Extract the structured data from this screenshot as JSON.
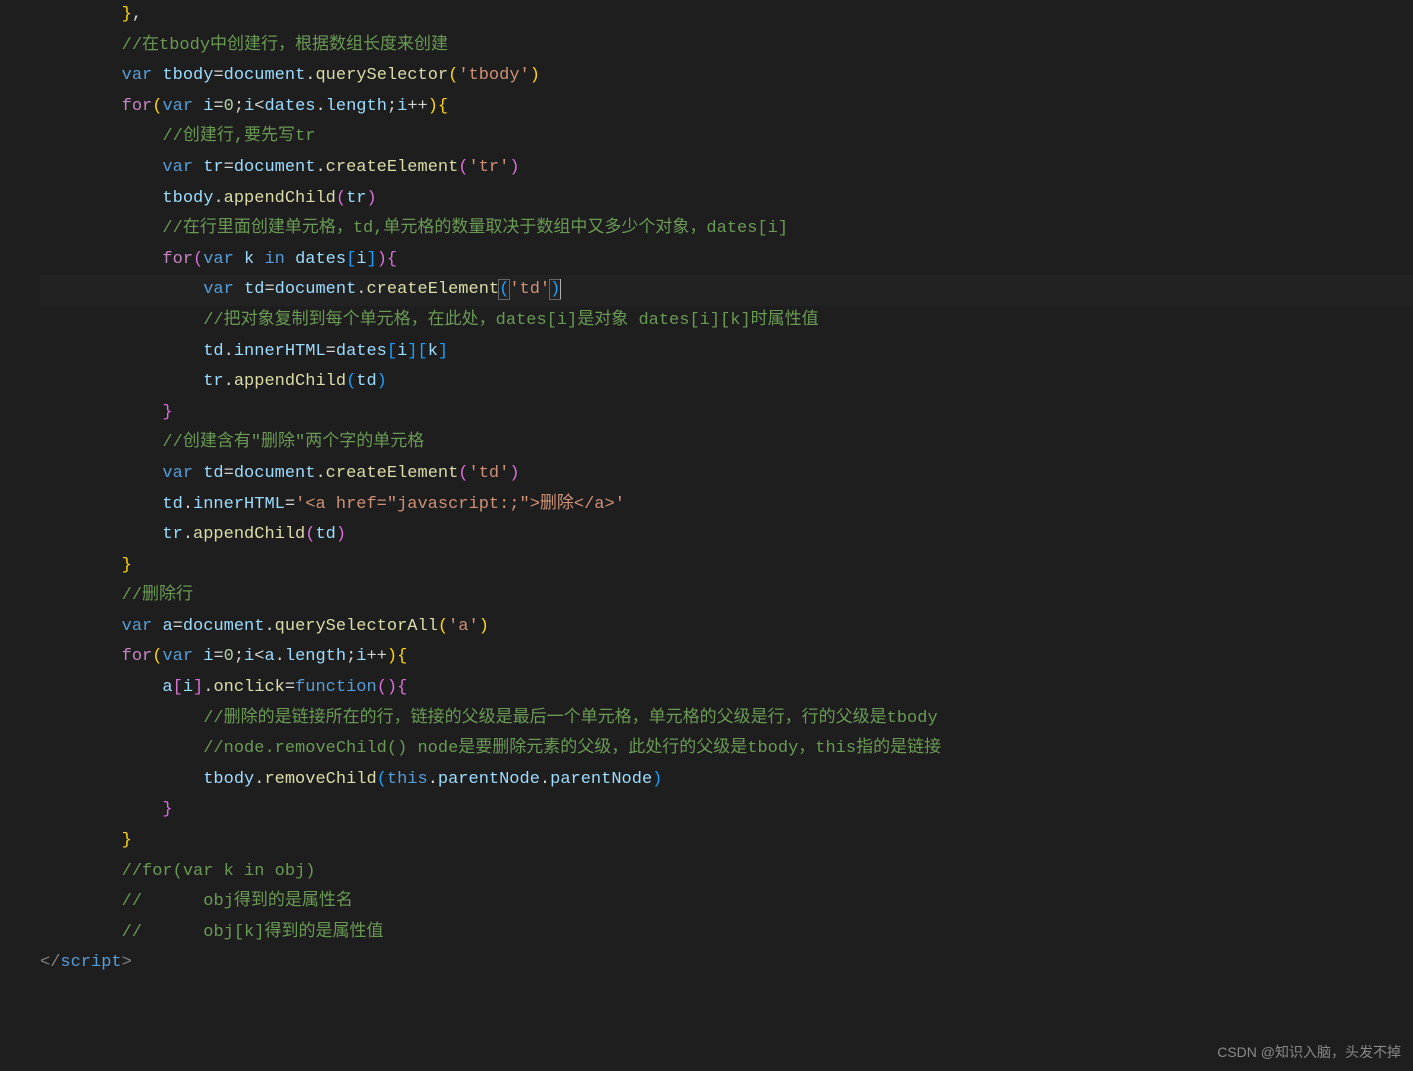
{
  "code": {
    "lines": [
      {
        "indent": 2,
        "tokens": [
          {
            "t": "}",
            "c": "bracket-y"
          },
          {
            "t": ",",
            "c": "punct"
          }
        ]
      },
      {
        "indent": 2,
        "tokens": [
          {
            "t": "//在tbody中创建行，根据数组长度来创建",
            "c": "comment"
          }
        ]
      },
      {
        "indent": 2,
        "tokens": [
          {
            "t": "var",
            "c": "kw-blue"
          },
          {
            "t": " ",
            "c": ""
          },
          {
            "t": "tbody",
            "c": "var"
          },
          {
            "t": "=",
            "c": "punct"
          },
          {
            "t": "document",
            "c": "var"
          },
          {
            "t": ".",
            "c": "punct"
          },
          {
            "t": "querySelector",
            "c": "func"
          },
          {
            "t": "(",
            "c": "bracket-y"
          },
          {
            "t": "'tbody'",
            "c": "string"
          },
          {
            "t": ")",
            "c": "bracket-y"
          }
        ]
      },
      {
        "indent": 2,
        "tokens": [
          {
            "t": "for",
            "c": "keyword"
          },
          {
            "t": "(",
            "c": "bracket-y"
          },
          {
            "t": "var",
            "c": "kw-blue"
          },
          {
            "t": " ",
            "c": ""
          },
          {
            "t": "i",
            "c": "var"
          },
          {
            "t": "=",
            "c": "punct"
          },
          {
            "t": "0",
            "c": "num"
          },
          {
            "t": ";",
            "c": "punct"
          },
          {
            "t": "i",
            "c": "var"
          },
          {
            "t": "<",
            "c": "punct"
          },
          {
            "t": "dates",
            "c": "var"
          },
          {
            "t": ".",
            "c": "punct"
          },
          {
            "t": "length",
            "c": "var"
          },
          {
            "t": ";",
            "c": "punct"
          },
          {
            "t": "i",
            "c": "var"
          },
          {
            "t": "++",
            "c": "punct"
          },
          {
            "t": ")",
            "c": "bracket-y"
          },
          {
            "t": "{",
            "c": "bracket-y"
          }
        ]
      },
      {
        "indent": 3,
        "tokens": [
          {
            "t": "//创建行,要先写tr",
            "c": "comment"
          }
        ]
      },
      {
        "indent": 3,
        "tokens": [
          {
            "t": "var",
            "c": "kw-blue"
          },
          {
            "t": " ",
            "c": ""
          },
          {
            "t": "tr",
            "c": "var"
          },
          {
            "t": "=",
            "c": "punct"
          },
          {
            "t": "document",
            "c": "var"
          },
          {
            "t": ".",
            "c": "punct"
          },
          {
            "t": "createElement",
            "c": "func"
          },
          {
            "t": "(",
            "c": "bracket-p"
          },
          {
            "t": "'tr'",
            "c": "string"
          },
          {
            "t": ")",
            "c": "bracket-p"
          }
        ]
      },
      {
        "indent": 3,
        "tokens": [
          {
            "t": "tbody",
            "c": "var"
          },
          {
            "t": ".",
            "c": "punct"
          },
          {
            "t": "appendChild",
            "c": "func"
          },
          {
            "t": "(",
            "c": "bracket-p"
          },
          {
            "t": "tr",
            "c": "var"
          },
          {
            "t": ")",
            "c": "bracket-p"
          }
        ]
      },
      {
        "indent": 3,
        "tokens": [
          {
            "t": "//在行里面创建单元格，td,单元格的数量取决于数组中又多少个对象，dates[i]",
            "c": "comment"
          }
        ]
      },
      {
        "indent": 3,
        "tokens": [
          {
            "t": "for",
            "c": "keyword"
          },
          {
            "t": "(",
            "c": "bracket-p"
          },
          {
            "t": "var",
            "c": "kw-blue"
          },
          {
            "t": " ",
            "c": ""
          },
          {
            "t": "k",
            "c": "var"
          },
          {
            "t": " ",
            "c": ""
          },
          {
            "t": "in",
            "c": "kw-blue"
          },
          {
            "t": " ",
            "c": ""
          },
          {
            "t": "dates",
            "c": "var"
          },
          {
            "t": "[",
            "c": "bracket-b"
          },
          {
            "t": "i",
            "c": "var"
          },
          {
            "t": "]",
            "c": "bracket-b"
          },
          {
            "t": ")",
            "c": "bracket-p"
          },
          {
            "t": "{",
            "c": "bracket-p"
          }
        ]
      },
      {
        "indent": 4,
        "cursor": true,
        "tokens": [
          {
            "t": "var",
            "c": "kw-blue"
          },
          {
            "t": " ",
            "c": ""
          },
          {
            "t": "td",
            "c": "var"
          },
          {
            "t": "=",
            "c": "punct"
          },
          {
            "t": "document",
            "c": "var"
          },
          {
            "t": ".",
            "c": "punct"
          },
          {
            "t": "createElement",
            "c": "func"
          },
          {
            "t": "(",
            "c": "bracket-b",
            "hl": true
          },
          {
            "t": "'td'",
            "c": "string"
          },
          {
            "t": ")",
            "c": "bracket-b",
            "hl": true,
            "cursor": true
          }
        ]
      },
      {
        "indent": 4,
        "tokens": [
          {
            "t": "//把对象复制到每个单元格，在此处，dates[i]是对象 dates[i][k]时属性值",
            "c": "comment"
          }
        ]
      },
      {
        "indent": 4,
        "tokens": [
          {
            "t": "td",
            "c": "var"
          },
          {
            "t": ".",
            "c": "punct"
          },
          {
            "t": "innerHTML",
            "c": "var"
          },
          {
            "t": "=",
            "c": "punct"
          },
          {
            "t": "dates",
            "c": "var"
          },
          {
            "t": "[",
            "c": "bracket-b"
          },
          {
            "t": "i",
            "c": "var"
          },
          {
            "t": "]",
            "c": "bracket-b"
          },
          {
            "t": "[",
            "c": "bracket-b"
          },
          {
            "t": "k",
            "c": "var"
          },
          {
            "t": "]",
            "c": "bracket-b"
          }
        ]
      },
      {
        "indent": 4,
        "tokens": [
          {
            "t": "tr",
            "c": "var"
          },
          {
            "t": ".",
            "c": "punct"
          },
          {
            "t": "appendChild",
            "c": "func"
          },
          {
            "t": "(",
            "c": "bracket-b"
          },
          {
            "t": "td",
            "c": "var"
          },
          {
            "t": ")",
            "c": "bracket-b"
          }
        ]
      },
      {
        "indent": 3,
        "tokens": [
          {
            "t": "}",
            "c": "bracket-p"
          }
        ]
      },
      {
        "indent": 3,
        "tokens": [
          {
            "t": "//创建含有\"删除\"两个字的单元格",
            "c": "comment"
          }
        ]
      },
      {
        "indent": 3,
        "tokens": [
          {
            "t": "var",
            "c": "kw-blue"
          },
          {
            "t": " ",
            "c": ""
          },
          {
            "t": "td",
            "c": "var"
          },
          {
            "t": "=",
            "c": "punct"
          },
          {
            "t": "document",
            "c": "var"
          },
          {
            "t": ".",
            "c": "punct"
          },
          {
            "t": "createElement",
            "c": "func"
          },
          {
            "t": "(",
            "c": "bracket-p"
          },
          {
            "t": "'td'",
            "c": "string"
          },
          {
            "t": ")",
            "c": "bracket-p"
          }
        ]
      },
      {
        "indent": 3,
        "tokens": [
          {
            "t": "td",
            "c": "var"
          },
          {
            "t": ".",
            "c": "punct"
          },
          {
            "t": "innerHTML",
            "c": "var"
          },
          {
            "t": "=",
            "c": "punct"
          },
          {
            "t": "'<a href=\"javascript:;\">删除</a>'",
            "c": "string"
          }
        ]
      },
      {
        "indent": 3,
        "tokens": [
          {
            "t": "tr",
            "c": "var"
          },
          {
            "t": ".",
            "c": "punct"
          },
          {
            "t": "appendChild",
            "c": "func"
          },
          {
            "t": "(",
            "c": "bracket-p"
          },
          {
            "t": "td",
            "c": "var"
          },
          {
            "t": ")",
            "c": "bracket-p"
          }
        ]
      },
      {
        "indent": 2,
        "tokens": [
          {
            "t": "}",
            "c": "bracket-y"
          }
        ]
      },
      {
        "indent": 2,
        "tokens": [
          {
            "t": "//删除行",
            "c": "comment"
          }
        ]
      },
      {
        "indent": 2,
        "tokens": [
          {
            "t": "var",
            "c": "kw-blue"
          },
          {
            "t": " ",
            "c": ""
          },
          {
            "t": "a",
            "c": "var"
          },
          {
            "t": "=",
            "c": "punct"
          },
          {
            "t": "document",
            "c": "var"
          },
          {
            "t": ".",
            "c": "punct"
          },
          {
            "t": "querySelectorAll",
            "c": "func"
          },
          {
            "t": "(",
            "c": "bracket-y"
          },
          {
            "t": "'a'",
            "c": "string"
          },
          {
            "t": ")",
            "c": "bracket-y"
          }
        ]
      },
      {
        "indent": 2,
        "tokens": [
          {
            "t": "for",
            "c": "keyword"
          },
          {
            "t": "(",
            "c": "bracket-y"
          },
          {
            "t": "var",
            "c": "kw-blue"
          },
          {
            "t": " ",
            "c": ""
          },
          {
            "t": "i",
            "c": "var"
          },
          {
            "t": "=",
            "c": "punct"
          },
          {
            "t": "0",
            "c": "num"
          },
          {
            "t": ";",
            "c": "punct"
          },
          {
            "t": "i",
            "c": "var"
          },
          {
            "t": "<",
            "c": "punct"
          },
          {
            "t": "a",
            "c": "var"
          },
          {
            "t": ".",
            "c": "punct"
          },
          {
            "t": "length",
            "c": "var"
          },
          {
            "t": ";",
            "c": "punct"
          },
          {
            "t": "i",
            "c": "var"
          },
          {
            "t": "++",
            "c": "punct"
          },
          {
            "t": ")",
            "c": "bracket-y"
          },
          {
            "t": "{",
            "c": "bracket-y"
          }
        ]
      },
      {
        "indent": 3,
        "tokens": [
          {
            "t": "a",
            "c": "var"
          },
          {
            "t": "[",
            "c": "bracket-p"
          },
          {
            "t": "i",
            "c": "var"
          },
          {
            "t": "]",
            "c": "bracket-p"
          },
          {
            "t": ".",
            "c": "punct"
          },
          {
            "t": "onclick",
            "c": "func"
          },
          {
            "t": "=",
            "c": "punct"
          },
          {
            "t": "function",
            "c": "kw-blue"
          },
          {
            "t": "(",
            "c": "bracket-p"
          },
          {
            "t": ")",
            "c": "bracket-p"
          },
          {
            "t": "{",
            "c": "bracket-p"
          }
        ]
      },
      {
        "indent": 4,
        "tokens": [
          {
            "t": "//删除的是链接所在的行，链接的父级是最后一个单元格，单元格的父级是行，行的父级是tbody",
            "c": "comment"
          }
        ]
      },
      {
        "indent": 4,
        "tokens": [
          {
            "t": "//node.removeChild() node是要删除元素的父级，此处行的父级是tbody，this指的是链接",
            "c": "comment"
          }
        ]
      },
      {
        "indent": 4,
        "tokens": [
          {
            "t": "tbody",
            "c": "var"
          },
          {
            "t": ".",
            "c": "punct"
          },
          {
            "t": "removeChild",
            "c": "func"
          },
          {
            "t": "(",
            "c": "bracket-b"
          },
          {
            "t": "this",
            "c": "kw-blue"
          },
          {
            "t": ".",
            "c": "punct"
          },
          {
            "t": "parentNode",
            "c": "var"
          },
          {
            "t": ".",
            "c": "punct"
          },
          {
            "t": "parentNode",
            "c": "var"
          },
          {
            "t": ")",
            "c": "bracket-b"
          }
        ]
      },
      {
        "indent": 3,
        "tokens": [
          {
            "t": "}",
            "c": "bracket-p"
          }
        ]
      },
      {
        "indent": 2,
        "tokens": [
          {
            "t": "}",
            "c": "bracket-y"
          }
        ]
      },
      {
        "indent": 2,
        "tokens": [
          {
            "t": "//for(var k in obj)",
            "c": "comment"
          }
        ]
      },
      {
        "indent": 2,
        "tokens": [
          {
            "t": "//      obj得到的是属性名",
            "c": "comment"
          }
        ]
      },
      {
        "indent": 2,
        "tokens": [
          {
            "t": "//      obj[k]得到的是属性值",
            "c": "comment"
          }
        ]
      },
      {
        "indent": 0,
        "tokens": [
          {
            "t": "</",
            "c": "tag-gray"
          },
          {
            "t": "script",
            "c": "tag-blue"
          },
          {
            "t": ">",
            "c": "tag-gray"
          }
        ]
      }
    ]
  },
  "watermark": "CSDN @知识入脑，头发不掉"
}
